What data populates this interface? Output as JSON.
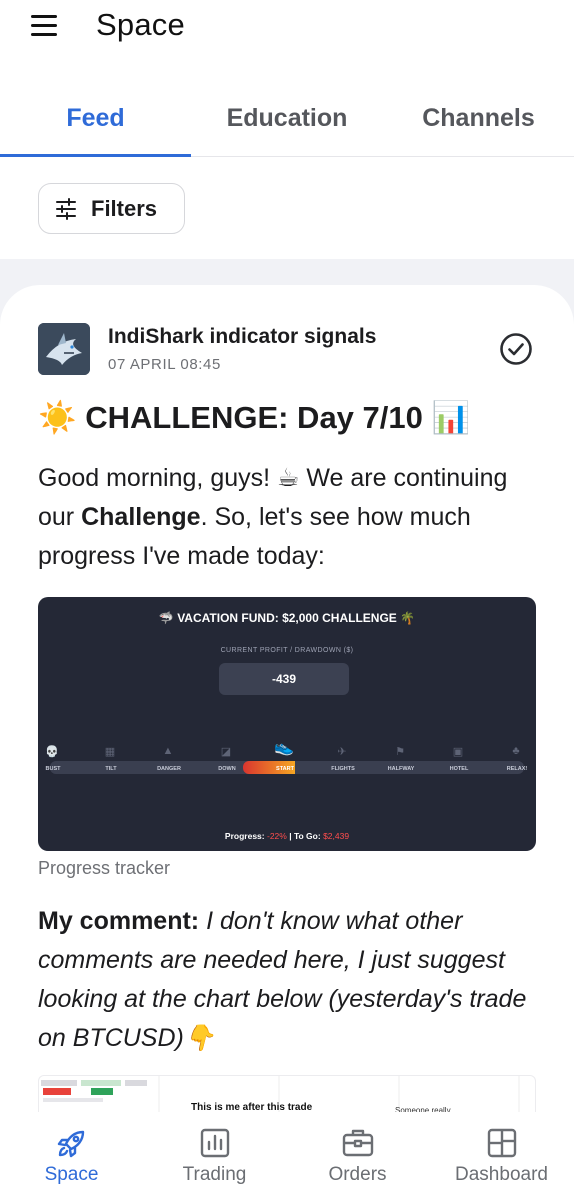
{
  "header": {
    "title": "Space"
  },
  "tabs": [
    {
      "label": "Feed",
      "active": true
    },
    {
      "label": "Education",
      "active": false
    },
    {
      "label": "Channels",
      "active": false
    }
  ],
  "filters": {
    "label": "Filters"
  },
  "post": {
    "channel_name": "IndiShark indicator signals",
    "date": "07 APRIL 08:45",
    "title_emoji_left": "☀️",
    "title": "CHALLENGE: Day 7/10",
    "title_emoji_right": "📊",
    "body_part1": "Good morning, guys! ☕ We are continuing our ",
    "body_bold": "Challenge",
    "body_part2": ". So, let's see how much progress I've made today:",
    "tracker": {
      "title": "🦈 VACATION FUND: $2,000 CHALLENGE 🌴",
      "subtitle": "CURRENT PROFIT / DRAWDOWN ($)",
      "value": "-439",
      "stops": [
        "BUST",
        "TILT",
        "DANGER",
        "DOWN",
        "START",
        "FLIGHTS",
        "HALFWAY",
        "HOTEL",
        "RELAX!"
      ],
      "progress_fraction": 0.22,
      "footer_progress_label": "Progress:",
      "footer_progress_value": "-22%",
      "footer_togo_label": "| To Go:",
      "footer_togo_value": "$2,439"
    },
    "image_caption": "Progress tracker",
    "comment_label": "My comment:",
    "comment_text": "I don't know what other comments are needed here, I just suggest looking at the chart below (yesterday's trade on BTCUSD)👇",
    "chart_preview": {
      "text_main": "This is me after this trade",
      "text_side": "Someone really"
    }
  },
  "bottom_nav": [
    {
      "label": "Space",
      "icon": "rocket-icon",
      "active": true
    },
    {
      "label": "Trading",
      "icon": "bar-chart-icon",
      "active": false
    },
    {
      "label": "Orders",
      "icon": "briefcase-icon",
      "active": false
    },
    {
      "label": "Dashboard",
      "icon": "dashboard-icon",
      "active": false
    }
  ],
  "colors": {
    "accent": "#2f6bd8",
    "tracker_bg": "#242836",
    "negative": "#ff4d4d"
  }
}
